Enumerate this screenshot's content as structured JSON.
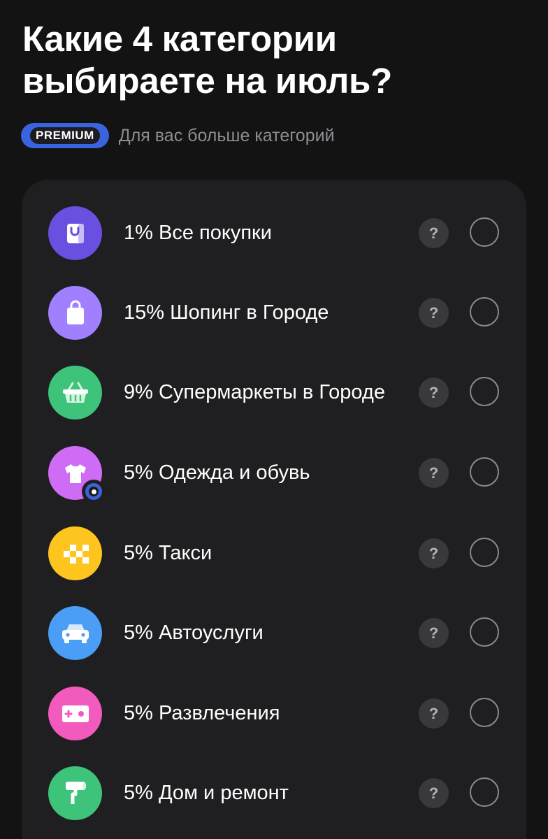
{
  "header": {
    "title": "Какие 4 категории выбираете на июль?",
    "premium_badge": "PREMIUM",
    "premium_text": "Для вас больше категорий"
  },
  "help_label": "?",
  "categories": [
    {
      "label": "1% Все покупки",
      "icon": "bag-icon",
      "color": "#6b4fe0",
      "selected": false
    },
    {
      "label": "15% Шопинг в Городе",
      "icon": "shopping-bag-icon",
      "color": "#a080ff",
      "selected": false
    },
    {
      "label": "9% Супермаркеты в Городе",
      "icon": "basket-icon",
      "color": "#3ec47a",
      "selected": false
    },
    {
      "label": "5% Одежда и обувь",
      "icon": "tshirt-icon",
      "color": "#cf6cf5",
      "selected": false,
      "badge": "location-badge-icon"
    },
    {
      "label": "5% Такси",
      "icon": "taxi-checker-icon",
      "color": "#ffc51f",
      "selected": false
    },
    {
      "label": "5% Автоуслуги",
      "icon": "car-icon",
      "color": "#4a9ef6",
      "selected": false
    },
    {
      "label": "5% Развлечения",
      "icon": "gamepad-icon",
      "color": "#f25bbd",
      "selected": false
    },
    {
      "label": "5% Дом и ремонт",
      "icon": "paint-roller-icon",
      "color": "#3ec47a",
      "selected": false
    }
  ]
}
